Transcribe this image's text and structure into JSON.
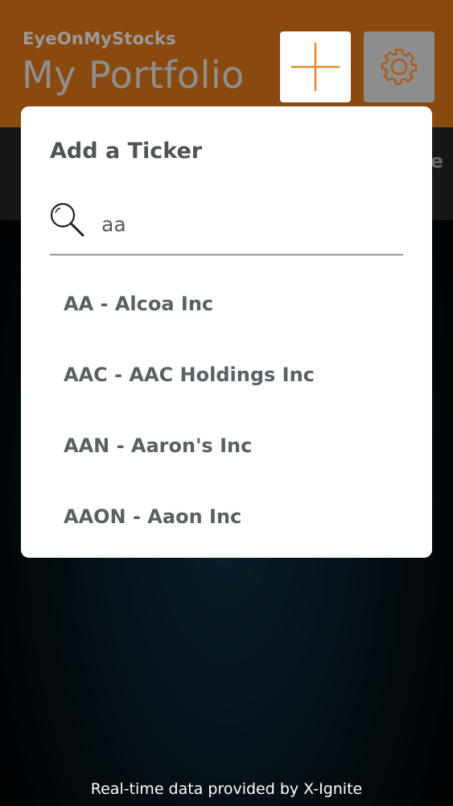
{
  "header": {
    "app_name": "EyeOnMyStocks",
    "page_title": "My Portfolio",
    "add_icon": "plus-icon",
    "settings_icon": "gear-icon"
  },
  "background_tab": {
    "label_fragment": "e"
  },
  "modal": {
    "title": "Add a Ticker",
    "search": {
      "value": "aa",
      "icon": "search-icon"
    },
    "results": [
      {
        "label": "AA - Alcoa Inc"
      },
      {
        "label": "AAC - AAC Holdings Inc"
      },
      {
        "label": "AAN - Aaron's Inc"
      },
      {
        "label": "AAON - Aaon Inc"
      }
    ]
  },
  "footer": {
    "attribution": "Real-time data provided by X-Ignite"
  },
  "colors": {
    "header_bg": "#8a4a0f",
    "accent_orange": "#e8892a",
    "modal_bg": "#ffffff",
    "text_dark": "#4e5458"
  }
}
